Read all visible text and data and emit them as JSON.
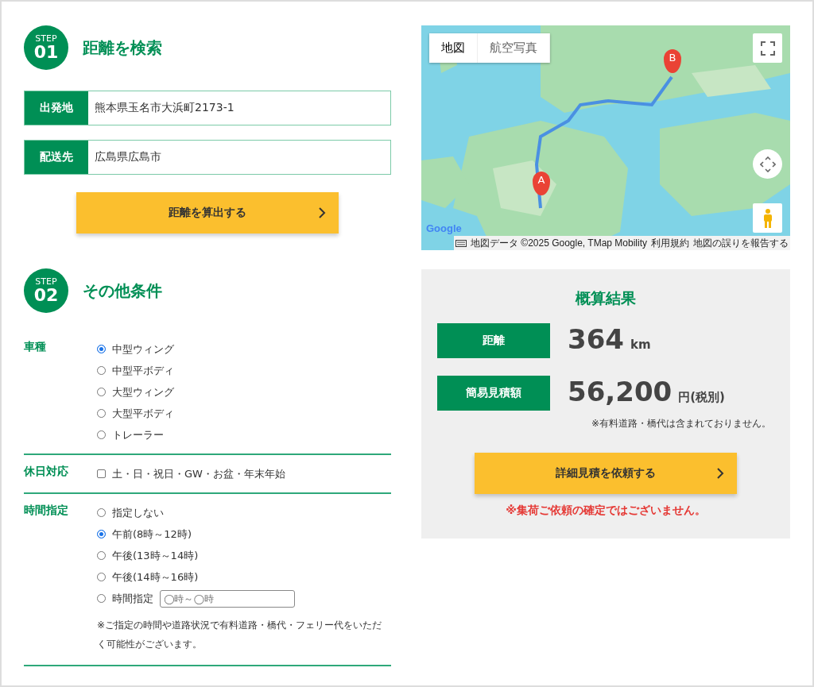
{
  "step1": {
    "step_label": "STEP",
    "number": "01",
    "title": "距離を検索"
  },
  "fields": [
    {
      "label": "出発地",
      "value": "熊本県玉名市大浜町2173-1"
    },
    {
      "label": "配送先",
      "value": "広島県広島市"
    }
  ],
  "calc_button": "距離を算出する",
  "step2": {
    "step_label": "STEP",
    "number": "02",
    "title": "その他条件"
  },
  "conditions": [
    {
      "label": "車種",
      "kind": "radio",
      "options": [
        {
          "label": "中型ウィング",
          "selected": true
        },
        {
          "label": "中型平ボディ",
          "selected": false
        },
        {
          "label": "大型ウィング",
          "selected": false
        },
        {
          "label": "大型平ボディ",
          "selected": false
        },
        {
          "label": "トレーラー",
          "selected": false
        }
      ]
    },
    {
      "label": "休日対応",
      "kind": "checkbox",
      "options": [
        {
          "label": "土・日・祝日・GW・お盆・年末年始",
          "checked": false
        }
      ]
    },
    {
      "label": "時間指定",
      "kind": "radio",
      "options": [
        {
          "label": "指定しない",
          "selected": false
        },
        {
          "label": "午前(8時～12時)",
          "selected": true
        },
        {
          "label": "午後(13時～14時)",
          "selected": false
        },
        {
          "label": "午後(14時～16時)",
          "selected": false
        },
        {
          "label": "時間指定",
          "selected": false,
          "placeholder": "◯時～◯時"
        }
      ],
      "note": "※ご指定の時間や道路状況で有料道路・橋代・フェリー代をいただく可能性がございます。"
    }
  ],
  "map": {
    "map_types": [
      {
        "label": "地図",
        "selected": true
      },
      {
        "label": "航空写真",
        "selected": false
      }
    ],
    "markers": [
      {
        "label": "A"
      },
      {
        "label": "B"
      }
    ],
    "logo": "Google",
    "attribution": "地図データ ©2025 Google, TMap Mobility",
    "terms": "利用規約",
    "report": "地図の誤りを報告する"
  },
  "result": {
    "title": "概算結果",
    "rows": [
      {
        "label": "距離",
        "value": "364",
        "unit": "km"
      },
      {
        "label": "簡易見積額",
        "value": "56,200",
        "unit": "円(税別)"
      }
    ],
    "note": "※有料道路・橋代は含まれておりません。",
    "button": "詳細見積を依頼する",
    "warning": "※集荷ご依頼の確定ではございません。"
  }
}
